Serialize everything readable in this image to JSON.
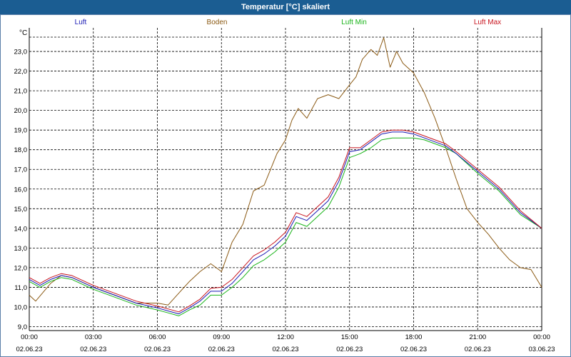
{
  "window": {
    "title": "Temperatur [°C] skaliert"
  },
  "chart_data": {
    "type": "line",
    "title": "Temperatur [°C] skaliert",
    "ylabel": "°C",
    "xlabel": "",
    "ylim": [
      8.8,
      24.2
    ],
    "yticks": [
      "9,0",
      "10,0",
      "11,0",
      "12,0",
      "13,0",
      "14,0",
      "15,0",
      "16,0",
      "17,0",
      "18,0",
      "19,0",
      "20,0",
      "21,0",
      "22,0",
      "23,0"
    ],
    "xlim": [
      0,
      24
    ],
    "xticks": [
      {
        "time": "00:00",
        "date": "02.06.23"
      },
      {
        "time": "03:00",
        "date": "02.06.23"
      },
      {
        "time": "06:00",
        "date": "02.06.23"
      },
      {
        "time": "09:00",
        "date": "02.06.23"
      },
      {
        "time": "12:00",
        "date": "02.06.23"
      },
      {
        "time": "15:00",
        "date": "02.06.23"
      },
      {
        "time": "18:00",
        "date": "02.06.23"
      },
      {
        "time": "21:00",
        "date": "02.06.23"
      },
      {
        "time": "00:00",
        "date": "03.06.23"
      }
    ],
    "grid": true,
    "legend_position": "top",
    "series": [
      {
        "name": "Luft",
        "color": "#1a1ab4",
        "x": [
          0,
          0.5,
          1,
          1.5,
          2,
          3,
          4,
          5,
          6,
          6.5,
          7,
          7.5,
          8,
          8.5,
          9,
          9.5,
          10,
          10.5,
          11,
          11.5,
          12,
          12.5,
          13,
          13.5,
          14,
          14.5,
          15,
          15.5,
          16,
          16.5,
          17,
          17.5,
          18,
          18.5,
          19,
          19.5,
          20,
          21,
          22,
          23,
          24
        ],
        "y": [
          11.4,
          11.1,
          11.4,
          11.6,
          11.5,
          11.0,
          10.6,
          10.2,
          9.95,
          9.8,
          9.65,
          9.95,
          10.3,
          10.8,
          10.8,
          11.2,
          11.8,
          12.4,
          12.7,
          13.1,
          13.6,
          14.6,
          14.4,
          14.9,
          15.4,
          16.4,
          17.9,
          18.0,
          18.4,
          18.8,
          18.9,
          18.9,
          18.8,
          18.6,
          18.4,
          18.2,
          17.8,
          16.9,
          16.0,
          14.8,
          14.0
        ]
      },
      {
        "name": "Boden",
        "color": "#8b5a14",
        "x": [
          0,
          0.3,
          1,
          1.5,
          2,
          3,
          4,
          5,
          6,
          6.5,
          7,
          7.5,
          8,
          8.5,
          9,
          9.5,
          10,
          10.5,
          11,
          11.3,
          11.6,
          12,
          12.3,
          12.6,
          13,
          13.5,
          14,
          14.5,
          15,
          15.3,
          15.6,
          16,
          16.3,
          16.6,
          16.9,
          17.2,
          17.5,
          18,
          18.5,
          19,
          19.5,
          20,
          20.5,
          21,
          21.5,
          22,
          22.5,
          23,
          23.5,
          24
        ],
        "y": [
          10.6,
          10.3,
          11.2,
          11.6,
          11.5,
          11.0,
          10.6,
          10.2,
          10.2,
          10.1,
          10.7,
          11.3,
          11.8,
          12.2,
          11.8,
          13.3,
          14.2,
          15.9,
          16.2,
          17.0,
          17.8,
          18.5,
          19.5,
          20.1,
          19.6,
          20.6,
          20.8,
          20.6,
          21.3,
          21.7,
          22.6,
          23.1,
          22.8,
          23.7,
          22.2,
          23.0,
          22.4,
          21.9,
          20.9,
          19.6,
          18.1,
          16.5,
          15.0,
          14.3,
          13.7,
          13.0,
          12.4,
          12.0,
          11.9,
          11.0
        ]
      },
      {
        "name": "Luft Min",
        "color": "#1ab41a",
        "x": [
          0,
          0.5,
          1,
          1.5,
          2,
          3,
          4,
          5,
          6,
          6.5,
          7,
          7.5,
          8,
          8.5,
          9,
          9.5,
          10,
          10.5,
          11,
          11.5,
          12,
          12.5,
          13,
          13.5,
          14,
          14.5,
          15,
          15.5,
          16,
          16.5,
          17,
          17.5,
          18,
          18.5,
          19,
          19.5,
          20,
          21,
          22,
          23,
          24
        ],
        "y": [
          11.3,
          11.0,
          11.3,
          11.5,
          11.4,
          10.9,
          10.5,
          10.1,
          9.85,
          9.7,
          9.55,
          9.85,
          10.1,
          10.6,
          10.6,
          11.0,
          11.5,
          12.1,
          12.4,
          12.8,
          13.3,
          14.3,
          14.1,
          14.6,
          15.1,
          16.1,
          17.6,
          17.8,
          18.1,
          18.5,
          18.6,
          18.6,
          18.6,
          18.5,
          18.3,
          18.1,
          17.8,
          16.8,
          15.9,
          14.7,
          14.0
        ]
      },
      {
        "name": "Luft Max",
        "color": "#c8141e",
        "x": [
          0,
          0.5,
          1,
          1.5,
          2,
          3,
          4,
          5,
          6,
          6.5,
          7,
          7.5,
          8,
          8.5,
          9,
          9.5,
          10,
          10.5,
          11,
          11.5,
          12,
          12.5,
          13,
          13.5,
          14,
          14.5,
          15,
          15.5,
          16,
          16.5,
          17,
          17.5,
          18,
          18.5,
          19,
          19.5,
          20,
          21,
          22,
          23,
          24
        ],
        "y": [
          11.5,
          11.2,
          11.5,
          11.7,
          11.6,
          11.1,
          10.7,
          10.3,
          10.05,
          9.9,
          9.75,
          10.05,
          10.4,
          10.95,
          11.0,
          11.4,
          12.0,
          12.6,
          12.9,
          13.3,
          13.8,
          14.8,
          14.6,
          15.1,
          15.6,
          16.6,
          18.1,
          18.1,
          18.5,
          18.9,
          19.0,
          19.0,
          18.9,
          18.7,
          18.5,
          18.3,
          17.9,
          17.0,
          16.1,
          14.9,
          14.0
        ]
      }
    ]
  }
}
